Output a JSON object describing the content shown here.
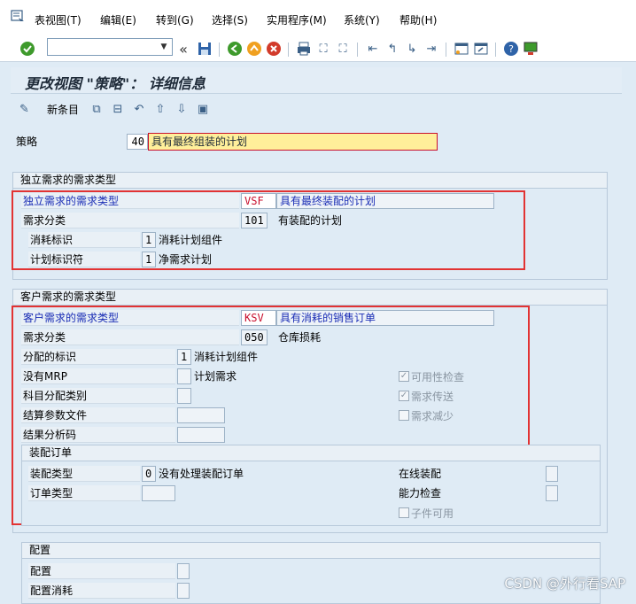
{
  "menu": [
    "表视图(T)",
    "编辑(E)",
    "转到(G)",
    "选择(S)",
    "实用程序(M)",
    "系统(Y)",
    "帮助(H)"
  ],
  "title": "更改视图 \"策略\"： 详细信息",
  "app_toolbar": {
    "new_entries": "新条目"
  },
  "strategy": {
    "label": "策略",
    "value": "40",
    "desc": "具有最终组装的计划"
  },
  "indep": {
    "group_title": "独立需求的需求类型",
    "req_type_label": "独立需求的需求类型",
    "req_type_value": "VSF",
    "req_type_desc": "具有最终装配的计划",
    "req_class_label": "需求分类",
    "req_class_value": "101",
    "req_class_desc": "有装配的计划",
    "consumption_label": "消耗标识",
    "consumption_value": "1",
    "consumption_desc": "消耗计划组件",
    "planning_label": "计划标识符",
    "planning_value": "1",
    "planning_desc": "净需求计划"
  },
  "cust": {
    "group_title": "客户需求的需求类型",
    "req_type_label": "客户需求的需求类型",
    "req_type_value": "KSV",
    "req_type_desc": "具有消耗的销售订单",
    "req_class_label": "需求分类",
    "req_class_value": "050",
    "req_class_desc": "仓库损耗",
    "alloc_label": "分配的标识",
    "alloc_value": "1",
    "alloc_desc": "消耗计划组件",
    "no_mrp_label": "没有MRP",
    "no_mrp_desc": "计划需求",
    "acct_label": "科目分配类别",
    "settle_label": "结算参数文件",
    "result_label": "结果分析码",
    "avail_check": "可用性检查",
    "req_transfer": "需求传送",
    "req_reduce": "需求减少"
  },
  "assembly": {
    "group_title": "装配订单",
    "type_label": "装配类型",
    "type_value": "0",
    "type_desc": "没有处理装配订单",
    "order_type_label": "订单类型",
    "online_label": "在线装配",
    "capacity_label": "能力检查",
    "component_label": "子件可用"
  },
  "config": {
    "group_title": "配置",
    "config_label": "配置",
    "consumption_label": "配置消耗"
  },
  "watermark": "CSDN @外行看SAP",
  "colors": {
    "highlight": "#ffef9a",
    "red_box": "#e23333",
    "accent_blue": "#1a2db5"
  }
}
